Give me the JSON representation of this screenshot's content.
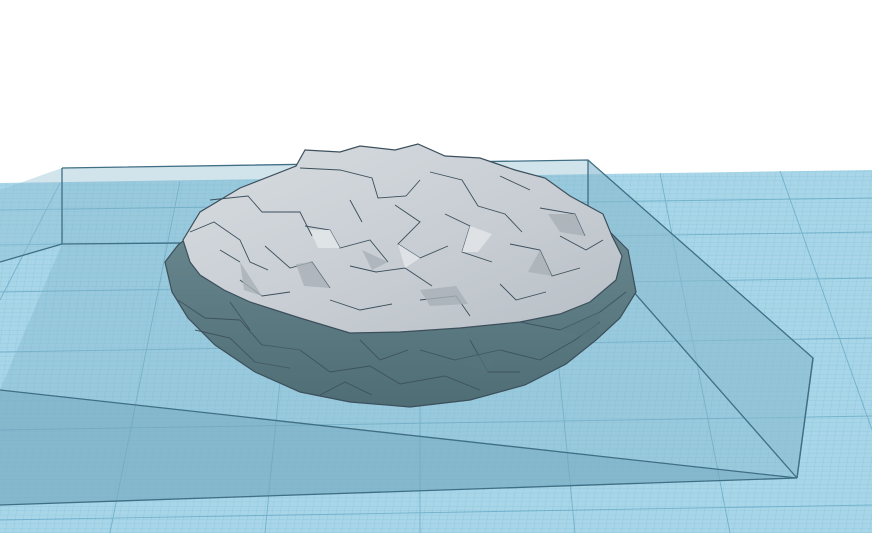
{
  "scene": {
    "background_color": "#ffffff",
    "workplane_color": "#86c3dc",
    "workplane_grid_color": "#5aa7c8",
    "bounding_box_color": "#3f6f85",
    "shape_top_color": "#c9ced3",
    "shape_side_color": "#5f7f86",
    "shape_edge_color": "#3c4f5c",
    "objects": [
      {
        "name": "workplane-grid",
        "kind": "grid"
      },
      {
        "name": "selection-bounding-box",
        "kind": "box"
      },
      {
        "name": "rock-shape",
        "kind": "polyhedral-mesh"
      }
    ]
  }
}
